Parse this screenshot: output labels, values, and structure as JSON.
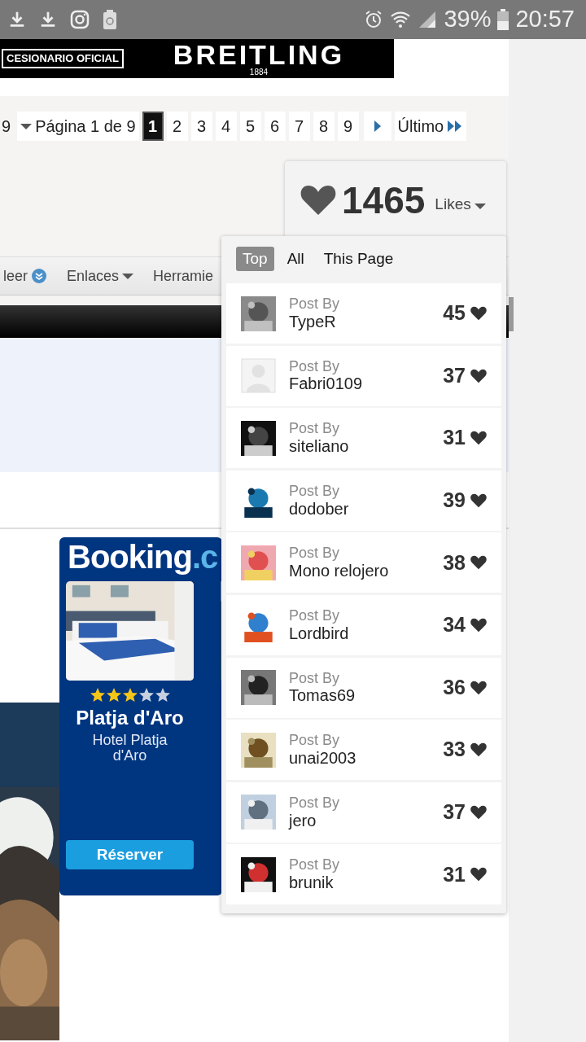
{
  "status_bar": {
    "battery": "39%",
    "time": "20:57"
  },
  "banner": {
    "tagline": "CESIONARIO OFICIAL",
    "brand": "BREITLING",
    "year": "1884"
  },
  "pagination": {
    "prev_fragment": "9",
    "page_label": "Página 1 de 9",
    "last": "Último",
    "pages": [
      {
        "label": "1",
        "selected": true
      },
      {
        "label": "2",
        "selected": false
      },
      {
        "label": "3",
        "selected": false
      },
      {
        "label": "4",
        "selected": false
      },
      {
        "label": "5",
        "selected": false
      },
      {
        "label": "6",
        "selected": false
      },
      {
        "label": "7",
        "selected": false
      },
      {
        "label": "8",
        "selected": false
      },
      {
        "label": "9",
        "selected": false
      }
    ]
  },
  "nav": [
    {
      "label": "leer",
      "kind": "badge"
    },
    {
      "label": "Enlaces",
      "kind": "dropdown"
    },
    {
      "label": "Herramie",
      "kind": "plain"
    }
  ],
  "ad": {
    "logo_main": "Booking",
    "logo_tail": ".c",
    "hotel": {
      "stars": 3,
      "city": "Platja d'Aro",
      "name": "Hotel Platja d'Aro",
      "button": "Réserver"
    }
  },
  "likes": {
    "count": "1465",
    "label": "Likes",
    "tabs": [
      {
        "label": "Top",
        "selected": true
      },
      {
        "label": "All",
        "selected": false
      },
      {
        "label": "This Page",
        "selected": false
      }
    ],
    "posts": [
      {
        "caption": "Post By",
        "user": "TypeR",
        "count": "45"
      },
      {
        "caption": "Post By",
        "user": "Fabri0109",
        "count": "37",
        "kind": "default"
      },
      {
        "caption": "Post By",
        "user": "siteliano",
        "count": "31"
      },
      {
        "caption": "Post By",
        "user": "dodober",
        "count": "39"
      },
      {
        "caption": "Post By",
        "user": "Mono relojero",
        "count": "38"
      },
      {
        "caption": "Post By",
        "user": "Lordbird",
        "count": "34"
      },
      {
        "caption": "Post By",
        "user": "Tomas69",
        "count": "36"
      },
      {
        "caption": "Post By",
        "user": "unai2003",
        "count": "33"
      },
      {
        "caption": "Post By",
        "user": "jero",
        "count": "37"
      },
      {
        "caption": "Post By",
        "user": "brunik",
        "count": "31"
      }
    ]
  }
}
